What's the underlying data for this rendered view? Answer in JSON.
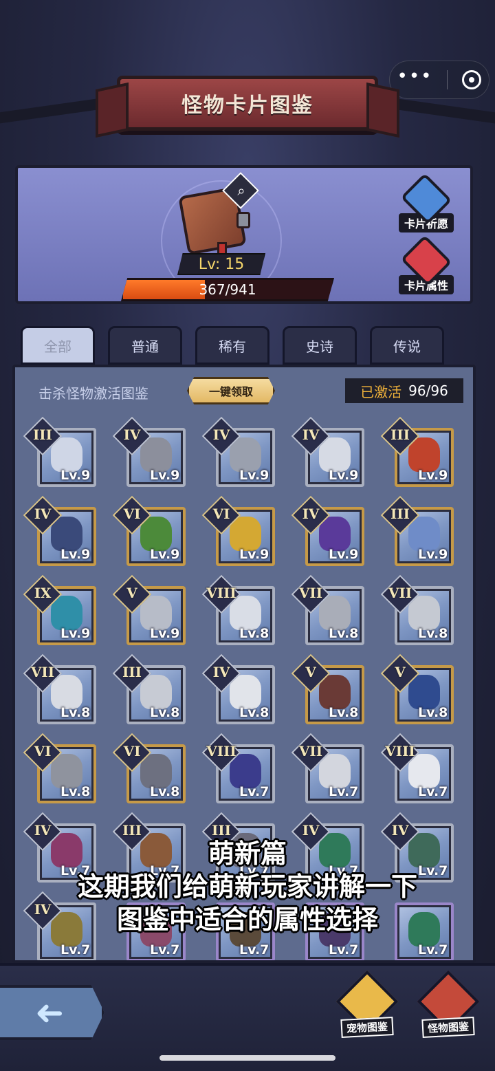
{
  "title": "怪物卡片图鉴",
  "capsule": {
    "more_icon": "more-dots-icon",
    "close_icon": "target-icon"
  },
  "book": {
    "level": "Lv: 15",
    "exp_text": "367/941",
    "exp_fraction": 0.39
  },
  "side_buttons": [
    {
      "label": "卡片祈愿",
      "icon": "card-pray-icon",
      "color": "#4f8ad8"
    },
    {
      "label": "卡片属性",
      "icon": "card-attribute-icon",
      "color": "#d8414a"
    }
  ],
  "tabs": [
    {
      "label": "全部",
      "active": true
    },
    {
      "label": "普通",
      "active": false
    },
    {
      "label": "稀有",
      "active": false
    },
    {
      "label": "史诗",
      "active": false
    },
    {
      "label": "传说",
      "active": false
    }
  ],
  "activate_label": "击杀怪物激活图鉴",
  "claim_label": "一键领取",
  "activated": {
    "label": "已激活",
    "value": "96/96"
  },
  "cards": [
    {
      "rank": "III",
      "lv": "Lv.9",
      "frame": "gray",
      "color": "#cfd6e6"
    },
    {
      "rank": "IV",
      "lv": "Lv.9",
      "frame": "gray",
      "color": "#8c8f9c"
    },
    {
      "rank": "IV",
      "lv": "Lv.9",
      "frame": "gray",
      "color": "#9aa0ae"
    },
    {
      "rank": "IV",
      "lv": "Lv.9",
      "frame": "gray",
      "color": "#d6dae4"
    },
    {
      "rank": "III",
      "lv": "Lv.9",
      "frame": "gold",
      "color": "#c0432c"
    },
    {
      "rank": "IV",
      "lv": "Lv.9",
      "frame": "gold",
      "color": "#3a4a7a"
    },
    {
      "rank": "VI",
      "lv": "Lv.9",
      "frame": "gold",
      "color": "#4c8a3a"
    },
    {
      "rank": "VI",
      "lv": "Lv.9",
      "frame": "gold",
      "color": "#d4a833"
    },
    {
      "rank": "IV",
      "lv": "Lv.9",
      "frame": "gold",
      "color": "#5a3a9a"
    },
    {
      "rank": "III",
      "lv": "Lv.9",
      "frame": "gold",
      "color": "#6f8cc8"
    },
    {
      "rank": "IX",
      "lv": "Lv.9",
      "frame": "gold",
      "color": "#2f8fa8"
    },
    {
      "rank": "V",
      "lv": "Lv.9",
      "frame": "gold",
      "color": "#b7bcc8"
    },
    {
      "rank": "VIII",
      "lv": "Lv.8",
      "frame": "gray",
      "color": "#d9dde6"
    },
    {
      "rank": "VII",
      "lv": "Lv.8",
      "frame": "gray",
      "color": "#a9adb8"
    },
    {
      "rank": "VII",
      "lv": "Lv.8",
      "frame": "gray",
      "color": "#c5c9d2"
    },
    {
      "rank": "VII",
      "lv": "Lv.8",
      "frame": "gray",
      "color": "#d8dbe3"
    },
    {
      "rank": "III",
      "lv": "Lv.8",
      "frame": "gray",
      "color": "#c7cbd4"
    },
    {
      "rank": "IV",
      "lv": "Lv.8",
      "frame": "gray",
      "color": "#e1e4ea"
    },
    {
      "rank": "V",
      "lv": "Lv.8",
      "frame": "gold",
      "color": "#6a3a36"
    },
    {
      "rank": "V",
      "lv": "Lv.8",
      "frame": "gold",
      "color": "#2f4b8f"
    },
    {
      "rank": "VI",
      "lv": "Lv.8",
      "frame": "gold",
      "color": "#8f939e"
    },
    {
      "rank": "VI",
      "lv": "Lv.8",
      "frame": "gold",
      "color": "#6d7080"
    },
    {
      "rank": "VIII",
      "lv": "Lv.7",
      "frame": "gray",
      "color": "#3b3c8c"
    },
    {
      "rank": "VII",
      "lv": "Lv.7",
      "frame": "gray",
      "color": "#d3d6de"
    },
    {
      "rank": "VIII",
      "lv": "Lv.7",
      "frame": "gray",
      "color": "#e6e8ee"
    },
    {
      "rank": "IV",
      "lv": "Lv.7",
      "frame": "gray",
      "color": "#8a3a6a"
    },
    {
      "rank": "III",
      "lv": "Lv.7",
      "frame": "gray",
      "color": "#8a5a3a"
    },
    {
      "rank": "III",
      "lv": "Lv.7",
      "frame": "gray",
      "color": "#6a6a7a"
    },
    {
      "rank": "IV",
      "lv": "Lv.7",
      "frame": "gray",
      "color": "#2f7a5a"
    },
    {
      "rank": "IV",
      "lv": "Lv.7",
      "frame": "gray",
      "color": "#3f6a5a"
    },
    {
      "rank": "IV",
      "lv": "Lv.7",
      "frame": "gray",
      "color": "#8a7a3a"
    },
    {
      "rank": "",
      "lv": "Lv.7",
      "frame": "purple",
      "color": "#8a4a6a"
    },
    {
      "rank": "",
      "lv": "Lv.7",
      "frame": "purple",
      "color": "#5a4a3a"
    },
    {
      "rank": "",
      "lv": "Lv.7",
      "frame": "purple",
      "color": "#4a3a6a"
    },
    {
      "rank": "",
      "lv": "Lv.7",
      "frame": "purple",
      "color": "#2f7a5a"
    }
  ],
  "bottom_nav": [
    {
      "label": "宠物图鉴",
      "icon": "pet-codex-icon",
      "color": "#e9b94a"
    },
    {
      "label": "怪物图鉴",
      "icon": "monster-codex-icon",
      "color": "#c44a3a"
    }
  ],
  "back_icon": "back-arrow-icon",
  "subtitles": [
    "萌新篇",
    "这期我们给萌新玩家讲解一下",
    "图鉴中适合的属性选择"
  ]
}
